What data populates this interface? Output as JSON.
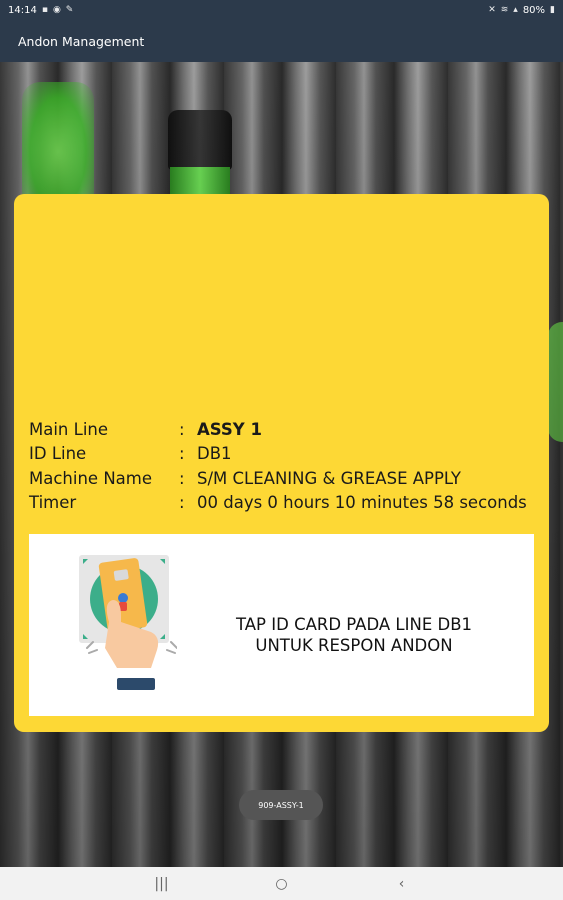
{
  "status_bar": {
    "time": "14:14",
    "battery": "80%"
  },
  "app_bar": {
    "title": "Andon Management"
  },
  "info": [
    {
      "label": "Main Line",
      "value": "ASSY 1"
    },
    {
      "label": "ID Line",
      "value": "DB1"
    },
    {
      "label": "Machine Name",
      "value": "S/M CLEANING & GREASE APPLY"
    },
    {
      "label": "Timer",
      "value": "00 days 0 hours 10 minutes 58 seconds"
    }
  ],
  "colon": ":",
  "instruction": {
    "line1": "TAP ID CARD PADA LINE DB1",
    "line2": "UNTUK RESPON ANDON"
  },
  "toast": {
    "text": "909-ASSY-1"
  },
  "colors": {
    "appbar": "#2c3a4b",
    "card": "#fdd835"
  }
}
